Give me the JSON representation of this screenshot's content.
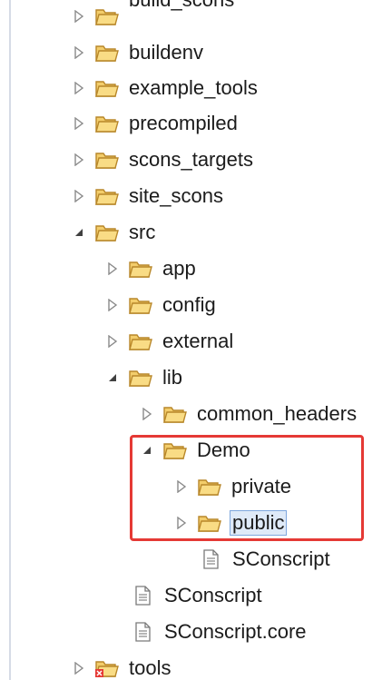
{
  "tree": {
    "items": [
      {
        "label": "build_scons",
        "type": "folder",
        "state": "collapsed"
      },
      {
        "label": "buildenv",
        "type": "folder",
        "state": "collapsed"
      },
      {
        "label": "example_tools",
        "type": "folder",
        "state": "collapsed"
      },
      {
        "label": "precompiled",
        "type": "folder",
        "state": "collapsed"
      },
      {
        "label": "scons_targets",
        "type": "folder",
        "state": "collapsed"
      },
      {
        "label": "site_scons",
        "type": "folder",
        "state": "collapsed"
      },
      {
        "label": "src",
        "type": "folder",
        "state": "expanded"
      },
      {
        "label": "app",
        "type": "folder",
        "state": "collapsed"
      },
      {
        "label": "config",
        "type": "folder",
        "state": "collapsed"
      },
      {
        "label": "external",
        "type": "folder",
        "state": "collapsed"
      },
      {
        "label": "lib",
        "type": "folder",
        "state": "expanded"
      },
      {
        "label": "common_headers",
        "type": "folder",
        "state": "collapsed"
      },
      {
        "label": "Demo",
        "type": "folder",
        "state": "expanded"
      },
      {
        "label": "private",
        "type": "folder",
        "state": "collapsed"
      },
      {
        "label": "public",
        "type": "folder",
        "state": "collapsed",
        "selected": true
      },
      {
        "label": "SConscript",
        "type": "file"
      },
      {
        "label": "SConscript",
        "type": "file"
      },
      {
        "label": "SConscript.core",
        "type": "file"
      },
      {
        "label": "tools",
        "type": "folder",
        "state": "collapsed",
        "error": true
      }
    ]
  },
  "colors": {
    "folder_fill": "#f5d57c",
    "folder_stroke": "#b8872a",
    "highlight_border": "#e53935",
    "selection_bg": "#dfeaf8",
    "selection_border": "#7fa7dd",
    "error_badge": "#e53935"
  },
  "icons": {
    "collapsed": "chevron-right-icon",
    "expanded": "triangle-down-icon",
    "folder": "folder-icon",
    "file": "file-icon",
    "error": "error-badge-icon"
  }
}
